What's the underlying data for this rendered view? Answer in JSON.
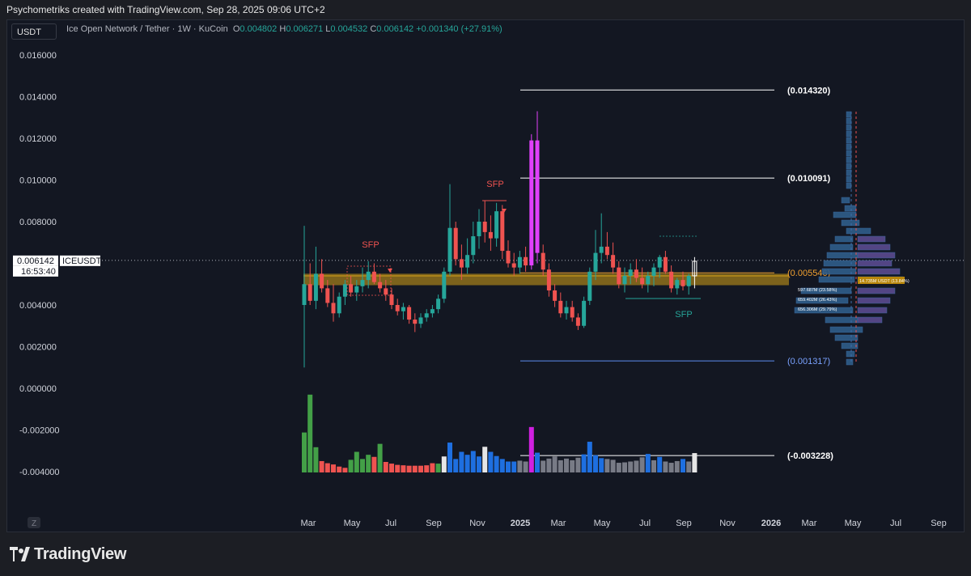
{
  "header": {
    "text": "Psychometriks created with TradingView.com, Sep 28, 2025 09:06 UTC+2"
  },
  "toolbar": {
    "unit": "USDT"
  },
  "legend": {
    "symbol": "Ice Open Network / Tether · 1W · KuCoin",
    "o_label": "O",
    "o": "0.004802",
    "h_label": "H",
    "h": "0.006271",
    "l_label": "L",
    "l": "0.004532",
    "c_label": "C",
    "c": "0.006142",
    "change": "+0.001340 (+27.91%)"
  },
  "price_tag": {
    "price": "0.006142",
    "ticker": "ICEUSDT",
    "countdown": "16:53:40"
  },
  "footer": {
    "brand": "TradingView",
    "z_label": "Z"
  },
  "colors": {
    "up": "#26a69a",
    "down": "#ef5350",
    "magenta": "#e040fb",
    "zone": "#d4a017",
    "level": "#ffffff",
    "level_low": "#5b8def",
    "bg": "#131722"
  },
  "chart_data": {
    "type": "candlestick",
    "ylim": [
      -0.0045,
      0.0168
    ],
    "y_ticks": [
      "0.016000",
      "0.014000",
      "0.012000",
      "0.010000",
      "0.008000",
      "0.006000",
      "0.004000",
      "0.002000",
      "0.000000",
      "-0.002000",
      "-0.004000"
    ],
    "y_tick_values": [
      0.016,
      0.014,
      0.012,
      0.01,
      0.008,
      0.006,
      0.004,
      0.002,
      0.0,
      -0.002,
      -0.004
    ],
    "x_ticks": [
      "Mar",
      "May",
      "Jul",
      "Sep",
      "Nov",
      "2025",
      "Mar",
      "May",
      "Jul",
      "Sep",
      "Nov",
      "2026",
      "Mar",
      "May",
      "Jul",
      "Sep"
    ],
    "fib_levels": [
      {
        "label": "(0.014320)",
        "value": 0.01432
      },
      {
        "label": "(0.010091)",
        "value": 0.010091
      },
      {
        "label": "(0.005546)",
        "value": 0.005546
      },
      {
        "label": "(0.001317)",
        "value": 0.001317
      },
      {
        "label": "(-0.003228)",
        "value": -0.003228
      }
    ],
    "annotations": [
      "SFP",
      "SFP",
      "SFP"
    ],
    "zone": [
      0.00495,
      0.0055
    ],
    "profile_labels": [
      "597.687M (23.58%)",
      "659.402M (26.43%)",
      "656.306M (29.79%)",
      "14.735M USDT (13.84%)"
    ],
    "candles": [
      [
        0.004,
        0.0078,
        0.001,
        0.005
      ],
      [
        0.005,
        0.006,
        0.004,
        0.0042
      ],
      [
        0.0042,
        0.0068,
        0.0038,
        0.0055
      ],
      [
        0.0055,
        0.0062,
        0.0046,
        0.0048
      ],
      [
        0.0048,
        0.0052,
        0.0039,
        0.0041
      ],
      [
        0.0041,
        0.005,
        0.0032,
        0.0036
      ],
      [
        0.0036,
        0.0046,
        0.0034,
        0.0044
      ],
      [
        0.0044,
        0.0052,
        0.004,
        0.005
      ],
      [
        0.005,
        0.0054,
        0.0044,
        0.0046
      ],
      [
        0.0046,
        0.0052,
        0.0042,
        0.0049
      ],
      [
        0.0049,
        0.0058,
        0.0046,
        0.0052
      ],
      [
        0.0052,
        0.0061,
        0.0048,
        0.0056
      ],
      [
        0.0056,
        0.006,
        0.005,
        0.0051
      ],
      [
        0.0051,
        0.0055,
        0.0046,
        0.0048
      ],
      [
        0.0048,
        0.0052,
        0.0042,
        0.0045
      ],
      [
        0.0045,
        0.0048,
        0.0038,
        0.004
      ],
      [
        0.004,
        0.0043,
        0.0035,
        0.0037
      ],
      [
        0.0037,
        0.0041,
        0.0033,
        0.0039
      ],
      [
        0.0039,
        0.004,
        0.0031,
        0.0033
      ],
      [
        0.0033,
        0.0036,
        0.0027,
        0.0031
      ],
      [
        0.0031,
        0.0036,
        0.0029,
        0.0034
      ],
      [
        0.0034,
        0.0038,
        0.0032,
        0.0036
      ],
      [
        0.0036,
        0.004,
        0.0034,
        0.0038
      ],
      [
        0.0038,
        0.0045,
        0.0036,
        0.0043
      ],
      [
        0.0043,
        0.0058,
        0.0041,
        0.0056
      ],
      [
        0.0056,
        0.0098,
        0.0054,
        0.0077
      ],
      [
        0.0077,
        0.008,
        0.0059,
        0.0062
      ],
      [
        0.0062,
        0.0069,
        0.0052,
        0.0058
      ],
      [
        0.0058,
        0.0072,
        0.0055,
        0.0064
      ],
      [
        0.0064,
        0.008,
        0.006,
        0.0073
      ],
      [
        0.0073,
        0.0086,
        0.0067,
        0.008
      ],
      [
        0.008,
        0.009,
        0.007,
        0.0075
      ],
      [
        0.0075,
        0.0083,
        0.0066,
        0.0072
      ],
      [
        0.0072,
        0.0089,
        0.0068,
        0.0085
      ],
      [
        0.0085,
        0.0088,
        0.0062,
        0.0066
      ],
      [
        0.0066,
        0.0071,
        0.0058,
        0.006
      ],
      [
        0.006,
        0.0065,
        0.0054,
        0.0058
      ],
      [
        0.0058,
        0.0066,
        0.0055,
        0.0063
      ],
      [
        0.0063,
        0.0068,
        0.0056,
        0.0059
      ],
      [
        0.0059,
        0.0122,
        0.0057,
        0.0119
      ],
      [
        0.0119,
        0.0133,
        0.006,
        0.0065
      ],
      [
        0.0065,
        0.0069,
        0.0054,
        0.0057
      ],
      [
        0.0057,
        0.006,
        0.0044,
        0.0047
      ],
      [
        0.0047,
        0.005,
        0.0039,
        0.0042
      ],
      [
        0.0042,
        0.0046,
        0.0034,
        0.0036
      ],
      [
        0.0036,
        0.0042,
        0.0033,
        0.0039
      ],
      [
        0.0039,
        0.0042,
        0.0032,
        0.0034
      ],
      [
        0.0034,
        0.0036,
        0.0028,
        0.003
      ],
      [
        0.003,
        0.0044,
        0.0029,
        0.0042
      ],
      [
        0.0042,
        0.0058,
        0.004,
        0.0056
      ],
      [
        0.0056,
        0.0076,
        0.0052,
        0.0065
      ],
      [
        0.0065,
        0.0084,
        0.006,
        0.0068
      ],
      [
        0.0068,
        0.0075,
        0.0062,
        0.0064
      ],
      [
        0.0064,
        0.007,
        0.0055,
        0.0058
      ],
      [
        0.0058,
        0.0061,
        0.0048,
        0.005
      ],
      [
        0.005,
        0.0058,
        0.0046,
        0.0054
      ],
      [
        0.0054,
        0.006,
        0.005,
        0.0057
      ],
      [
        0.0057,
        0.0062,
        0.0051,
        0.0053
      ],
      [
        0.0053,
        0.0058,
        0.0048,
        0.005
      ],
      [
        0.005,
        0.0056,
        0.0046,
        0.0054
      ],
      [
        0.0054,
        0.006,
        0.0049,
        0.0058
      ],
      [
        0.0058,
        0.0064,
        0.0053,
        0.0063
      ],
      [
        0.0063,
        0.0066,
        0.0055,
        0.0056
      ],
      [
        0.0056,
        0.0059,
        0.0046,
        0.0048
      ],
      [
        0.0048,
        0.0053,
        0.0045,
        0.0052
      ],
      [
        0.0052,
        0.0056,
        0.0047,
        0.0049
      ],
      [
        0.0049,
        0.0055,
        0.0045,
        0.0054
      ],
      [
        0.0054,
        0.0063,
        0.0048,
        0.0061
      ]
    ],
    "volume": [
      9.5,
      18.5,
      6.0,
      2.7,
      2.2,
      1.9,
      1.4,
      1.1,
      3.0,
      4.9,
      3.2,
      4.2,
      3.7,
      6.8,
      2.5,
      2.1,
      1.8,
      1.7,
      1.6,
      1.6,
      1.6,
      1.7,
      2.2,
      2.1,
      3.8,
      7.1,
      3.2,
      4.9,
      4.2,
      5.1,
      3.8,
      6.1,
      4.9,
      3.9,
      3.2,
      2.6,
      2.6,
      2.8,
      2.6,
      10.8,
      4.7,
      2.8,
      3.3,
      3.8,
      2.9,
      3.3,
      2.9,
      3.5,
      4.3,
      7.3,
      4.1,
      3.4,
      3.2,
      3.0,
      2.3,
      2.4,
      2.6,
      2.8,
      3.6,
      4.4,
      2.9,
      3.7,
      2.6,
      2.3,
      2.7,
      3.2,
      2.6,
      4.6
    ],
    "volume_colors": [
      "g",
      "g",
      "g",
      "r",
      "r",
      "r",
      "r",
      "r",
      "g",
      "g",
      "g",
      "g",
      "r",
      "g",
      "r",
      "r",
      "r",
      "r",
      "r",
      "r",
      "r",
      "r",
      "r",
      "g",
      "w",
      "b",
      "b",
      "b",
      "b",
      "b",
      "b",
      "w",
      "b",
      "b",
      "b",
      "b",
      "b",
      "gr",
      "gr",
      "m",
      "b",
      "gr",
      "gr",
      "gr",
      "gr",
      "gr",
      "gr",
      "gr",
      "b",
      "b",
      "b",
      "b",
      "gr",
      "gr",
      "gr",
      "gr",
      "gr",
      "gr",
      "gr",
      "b",
      "gr",
      "b",
      "gr",
      "gr",
      "gr",
      "b",
      "gr",
      "w"
    ]
  }
}
